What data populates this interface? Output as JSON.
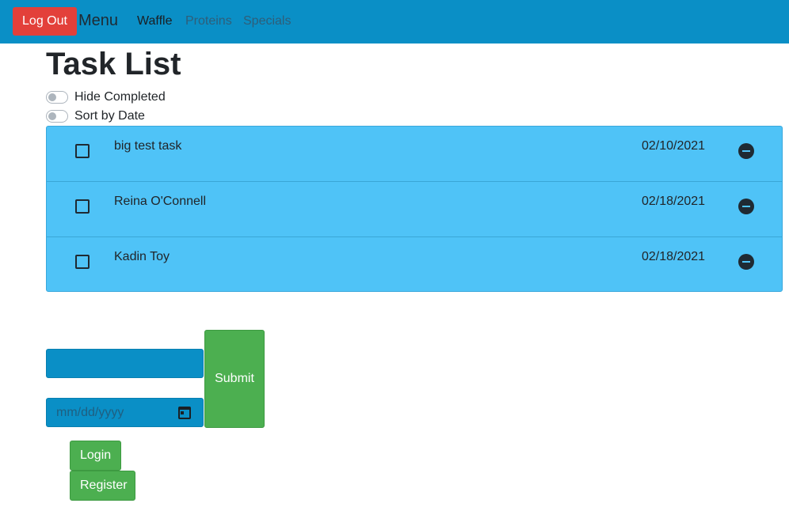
{
  "navbar": {
    "logout_label": "Log Out",
    "brand": "Menu",
    "links": [
      {
        "label": "Waffle",
        "active": true
      },
      {
        "label": "Proteins",
        "active": false
      },
      {
        "label": "Specials",
        "active": false
      }
    ],
    "bg_color": "#0a8fc6"
  },
  "page": {
    "title": "Task List"
  },
  "toggles": {
    "hide_completed": {
      "label": "Hide Completed",
      "on": false
    },
    "sort_by_date": {
      "label": "Sort by Date",
      "on": false
    }
  },
  "tasks": [
    {
      "name": "big test task",
      "date": "02/10/2021",
      "completed": false
    },
    {
      "name": "Reina O'Connell",
      "date": "02/18/2021",
      "completed": false
    },
    {
      "name": "Kadin Toy",
      "date": "02/18/2021",
      "completed": false
    }
  ],
  "form": {
    "task_input_value": "",
    "date_placeholder": "mm/dd/yyyy",
    "submit_label": "Submit"
  },
  "auth": {
    "login_label": "Login",
    "register_label": "Register"
  },
  "colors": {
    "accent": "#0a8fc6",
    "list_bg": "#4fc3f7",
    "danger": "#e3403a",
    "success": "#4caf50"
  }
}
